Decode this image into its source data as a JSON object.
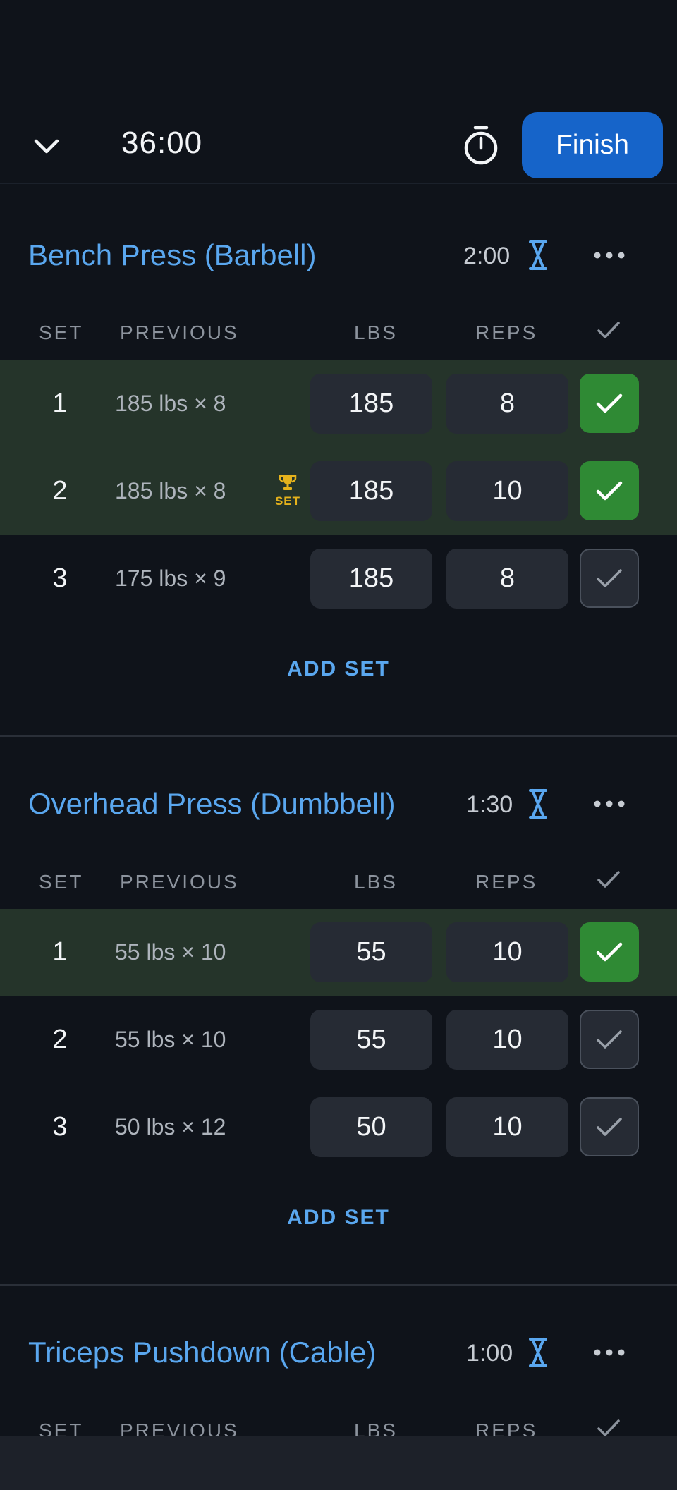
{
  "header": {
    "timer": "36:00",
    "finish_label": "Finish"
  },
  "columns": {
    "set": "SET",
    "previous": "PREVIOUS",
    "lbs": "LBS",
    "reps": "REPS"
  },
  "exercises": [
    {
      "title": "Bench Press (Barbell)",
      "rest": "2:00",
      "add_set_label": "ADD SET",
      "sets": [
        {
          "set": "1",
          "previous": "185 lbs × 8",
          "lbs": "185",
          "reps": "8",
          "completed": true
        },
        {
          "set": "2",
          "previous": "185 lbs × 8",
          "lbs": "185",
          "reps": "10",
          "completed": true,
          "badge": "SET"
        },
        {
          "set": "3",
          "previous": "175 lbs × 9",
          "lbs": "185",
          "reps": "8",
          "completed": false
        }
      ]
    },
    {
      "title": "Overhead Press (Dumbbell)",
      "rest": "1:30",
      "add_set_label": "ADD SET",
      "sets": [
        {
          "set": "1",
          "previous": "55 lbs × 10",
          "lbs": "55",
          "reps": "10",
          "completed": true
        },
        {
          "set": "2",
          "previous": "55 lbs × 10",
          "lbs": "55",
          "reps": "10",
          "completed": false
        },
        {
          "set": "3",
          "previous": "50 lbs × 12",
          "lbs": "50",
          "reps": "10",
          "completed": false
        }
      ]
    },
    {
      "title": "Triceps Pushdown (Cable)",
      "rest": "1:00"
    }
  ],
  "colors": {
    "accent": "#5aa7ef",
    "finish": "#1664c9",
    "done_row": "#25342a",
    "done_check": "#2f8a34",
    "trophy": "#e5b21c"
  },
  "icons": [
    "chevron-down-icon",
    "stopwatch-icon",
    "hourglass-icon",
    "more-icon",
    "check-icon",
    "trophy-icon"
  ]
}
